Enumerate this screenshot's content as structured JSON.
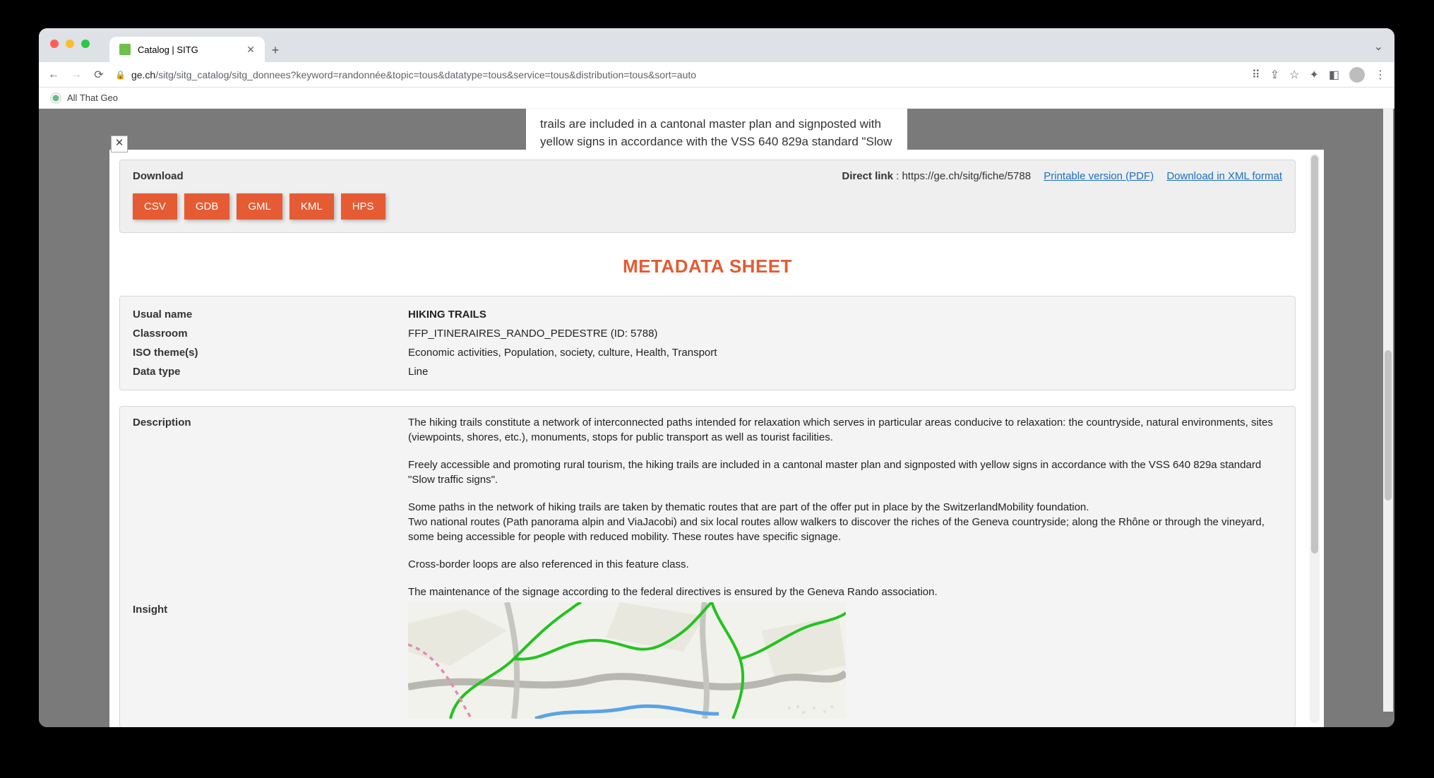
{
  "tab": {
    "title": "Catalog | SITG"
  },
  "url": {
    "domain": "ge.ch",
    "path": "/sitg/sitg_catalog/sitg_donnees?keyword=randonnée&topic=tous&datatype=tous&service=tous&distribution=tous&sort=auto"
  },
  "bookmark": {
    "label": "All That Geo"
  },
  "background_snippet": "trails are included in a cantonal master plan and signposted with yellow signs in accordance with the VSS 640 829a standard \"Slow traffic signs\".",
  "download": {
    "label": "Download",
    "formats": [
      "CSV",
      "GDB",
      "GML",
      "KML",
      "HPS"
    ],
    "direct_link_label": "Direct link",
    "direct_link_url": "https://ge.ch/sitg/fiche/5788",
    "printable": "Printable version (PDF)",
    "xml": "Download in XML format"
  },
  "sheet": {
    "title": "METADATA SHEET",
    "rows": [
      {
        "k": "Usual name",
        "v": "HIKING TRAILS",
        "bold": true
      },
      {
        "k": "Classroom",
        "v": "FFP_ITINERAIRES_RANDO_PEDESTRE (ID: 5788)"
      },
      {
        "k": "ISO theme(s)",
        "v": "Economic activities, Population, society, culture, Health, Transport"
      },
      {
        "k": "Data type",
        "v": "Line"
      }
    ],
    "description_label": "Description",
    "description_paragraphs": [
      "The hiking trails constitute a network of interconnected paths intended for relaxation which serves in particular areas conducive to relaxation: the countryside, natural environments, sites (viewpoints, shores, etc.), monuments, stops for public transport as well as tourist facilities.",
      "Freely accessible and promoting rural tourism, the hiking trails are included in a cantonal master plan and signposted with yellow signs in accordance with the VSS 640 829a standard \"Slow traffic signs\".",
      "Some paths in the network of hiking trails are taken by thematic routes that are part of the offer put in place by the SwitzerlandMobility foundation.\nTwo national routes (Path panorama alpin and ViaJacobi) and six local routes allow walkers to discover the riches of the Geneva countryside; along the Rhône or through the vineyard, some being accessible for people with reduced mobility. These routes have specific signage.",
      "Cross-border loops are also referenced in this feature class.",
      "The maintenance of the signage according to the federal directives is ensured by the Geneva Rando association."
    ],
    "insight_label": "Insight"
  }
}
